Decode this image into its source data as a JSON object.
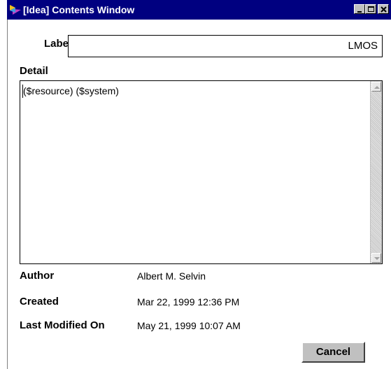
{
  "window": {
    "title": "[Idea] Contents Window",
    "colors": {
      "titlebar": "#000080",
      "button_face": "#c0c0c0"
    },
    "controls": [
      "minimize-icon",
      "maximize-icon",
      "close-icon"
    ]
  },
  "label": {
    "caption": "Label",
    "value": "LMOS"
  },
  "detail": {
    "caption": "Detail",
    "text": "($resource) ($system)"
  },
  "info": {
    "author_label": "Author",
    "author_value": "Albert M. Selvin",
    "created_label": "Created",
    "created_value": "Mar 22, 1999  12:36 PM",
    "modified_label": "Last Modified On",
    "modified_value": "May 21, 1999  10:07 AM"
  },
  "buttons": {
    "cancel": "Cancel"
  }
}
